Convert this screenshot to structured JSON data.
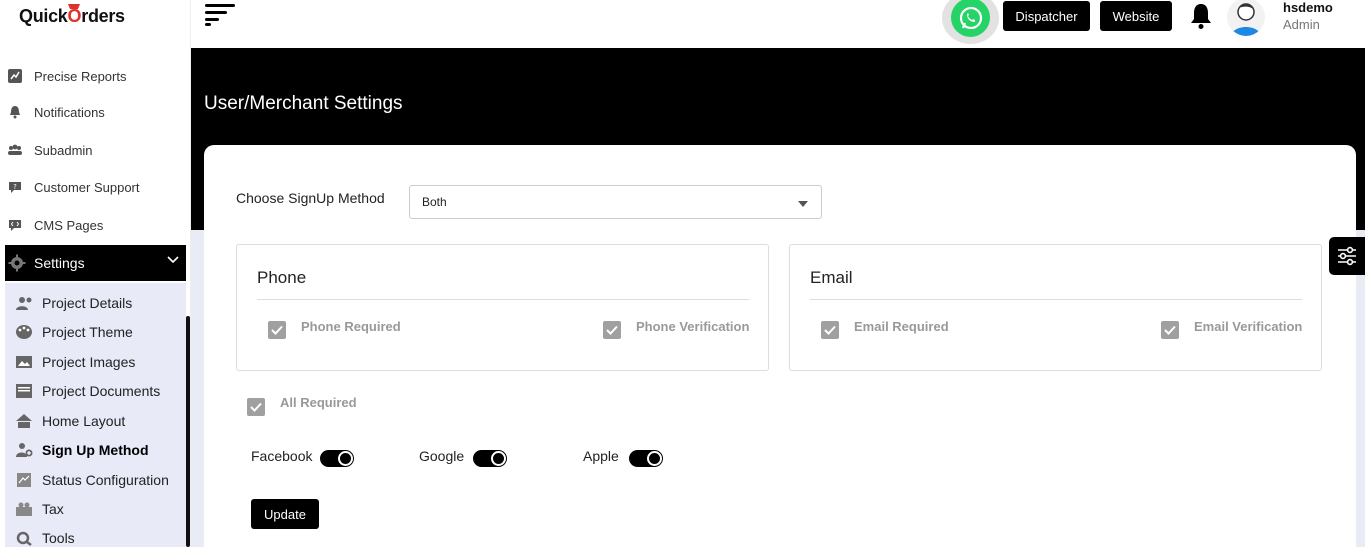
{
  "brand": {
    "logo_text_a": "Quick",
    "logo_text_o": "O",
    "logo_text_b": "rders"
  },
  "sidebar": {
    "items": [
      {
        "label": "Precise Reports",
        "icon": "chart-icon"
      },
      {
        "label": "Notifications",
        "icon": "bell-icon"
      },
      {
        "label": "Subadmin",
        "icon": "users-icon"
      },
      {
        "label": "Customer Support",
        "icon": "support-icon"
      },
      {
        "label": "CMS Pages",
        "icon": "code-icon"
      }
    ],
    "settings": {
      "label": "Settings",
      "icon": "gear-icon"
    },
    "submenu": [
      {
        "label": "Project Details",
        "icon": "user-gear-icon"
      },
      {
        "label": "Project Theme",
        "icon": "palette-icon"
      },
      {
        "label": "Project Images",
        "icon": "image-icon"
      },
      {
        "label": "Project Documents",
        "icon": "document-icon"
      },
      {
        "label": "Home Layout",
        "icon": "home-icon"
      },
      {
        "label": "Sign Up Method",
        "icon": "user-plus-icon"
      },
      {
        "label": "Status Configuration",
        "icon": "status-icon"
      },
      {
        "label": "Tax",
        "icon": "tax-icon"
      },
      {
        "label": "Tools",
        "icon": "tools-icon"
      }
    ]
  },
  "header": {
    "dispatcher_label": "Dispatcher",
    "website_label": "Website",
    "user_name": "hsdemo",
    "user_role": "Admin"
  },
  "page": {
    "title": "User/Merchant Settings",
    "signup_label": "Choose SignUp Method",
    "signup_value": "Both",
    "phone": {
      "title": "Phone",
      "required": "Phone Required",
      "verification": "Phone Verification"
    },
    "email": {
      "title": "Email",
      "required": "Email Required",
      "verification": "Email Verification"
    },
    "all_required": "All Required",
    "social": {
      "facebook": "Facebook",
      "google": "Google",
      "apple": "Apple"
    },
    "update_label": "Update"
  },
  "colors": {
    "accent": "#000000",
    "submenu_bg": "#e8eaf8",
    "whatsapp": "#25d366",
    "brand_red": "#e0312b"
  }
}
